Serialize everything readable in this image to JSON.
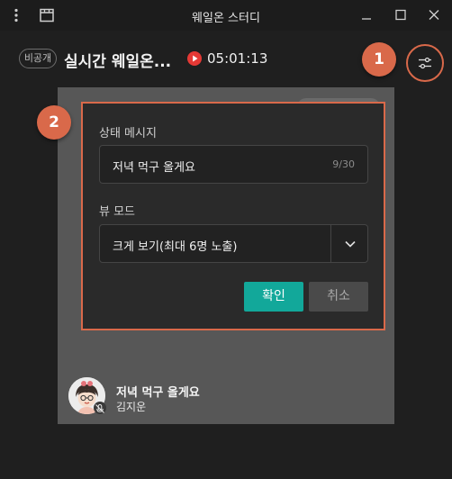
{
  "window": {
    "title": "웨일온 스터디",
    "menu_icon": "kebab-menu-icon",
    "layout_icon": "window-layout-icon",
    "controls": [
      "minimize-icon",
      "maximize-icon",
      "close-icon"
    ]
  },
  "header": {
    "privacy_badge": "비공개",
    "room_title": "실시간 웨일온...",
    "live_icon": "play-circle-icon",
    "timer": "05:01:13",
    "settings_icon": "settings-sliders-icon"
  },
  "callouts": [
    "1",
    "2"
  ],
  "dialog": {
    "status_label": "상태 메시지",
    "status_value": "저녁 먹구 올게요",
    "status_count": "9/30",
    "view_label": "뷰 모드",
    "view_value": "크게 보기(최대 6명 노출)",
    "confirm_label": "확인",
    "cancel_label": "취소"
  },
  "participant": {
    "status_message": "저녁 먹구 올게요",
    "name": "김지운",
    "mic_icon": "mic-off-icon"
  },
  "colors": {
    "background": "#1f1f1f",
    "video_background": "#575757",
    "dialog_background": "#2a2a2a",
    "highlight": "#d9694a",
    "confirm": "#12a89a",
    "live": "#e53935"
  }
}
